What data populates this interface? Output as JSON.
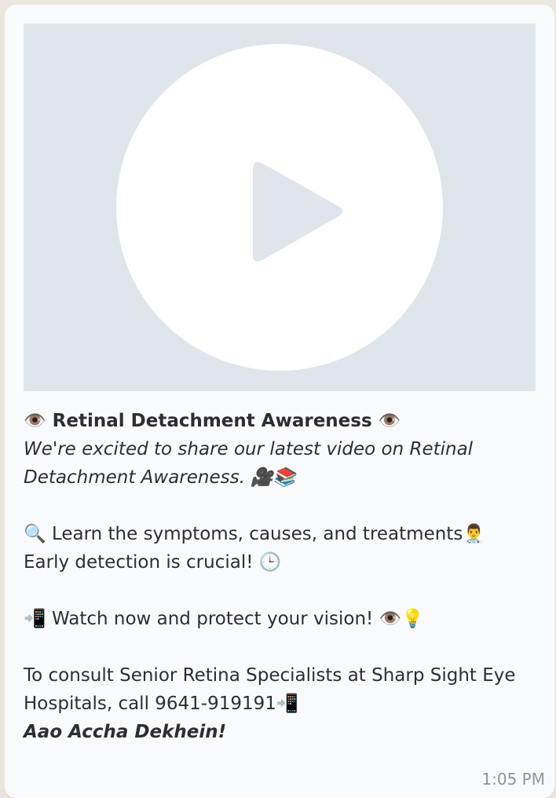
{
  "message": {
    "headline": {
      "icon_left": "👁️",
      "text": "Retinal Detachment Awareness",
      "icon_right": "👁️"
    },
    "intro_line1": "We're excited to share our latest video on Retinal",
    "intro_line2": "Detachment Awareness. 🎥📚",
    "learn_line": "🔍 Learn the symptoms, causes, and treatments👨‍⚕️",
    "early_line": "Early detection is crucial! 🕒",
    "watch_line": "📲 Watch now and protect your vision! 👁️💡",
    "consult_line1": "To consult Senior Retina Specialists at Sharp Sight Eye",
    "consult_line2": "Hospitals, call 9641-919191📲",
    "tagline": "Aao Accha Dekhein!",
    "time": "1:05 PM"
  },
  "video": {
    "icon": "play-icon",
    "placeholder_color": "#e0e5eb"
  }
}
